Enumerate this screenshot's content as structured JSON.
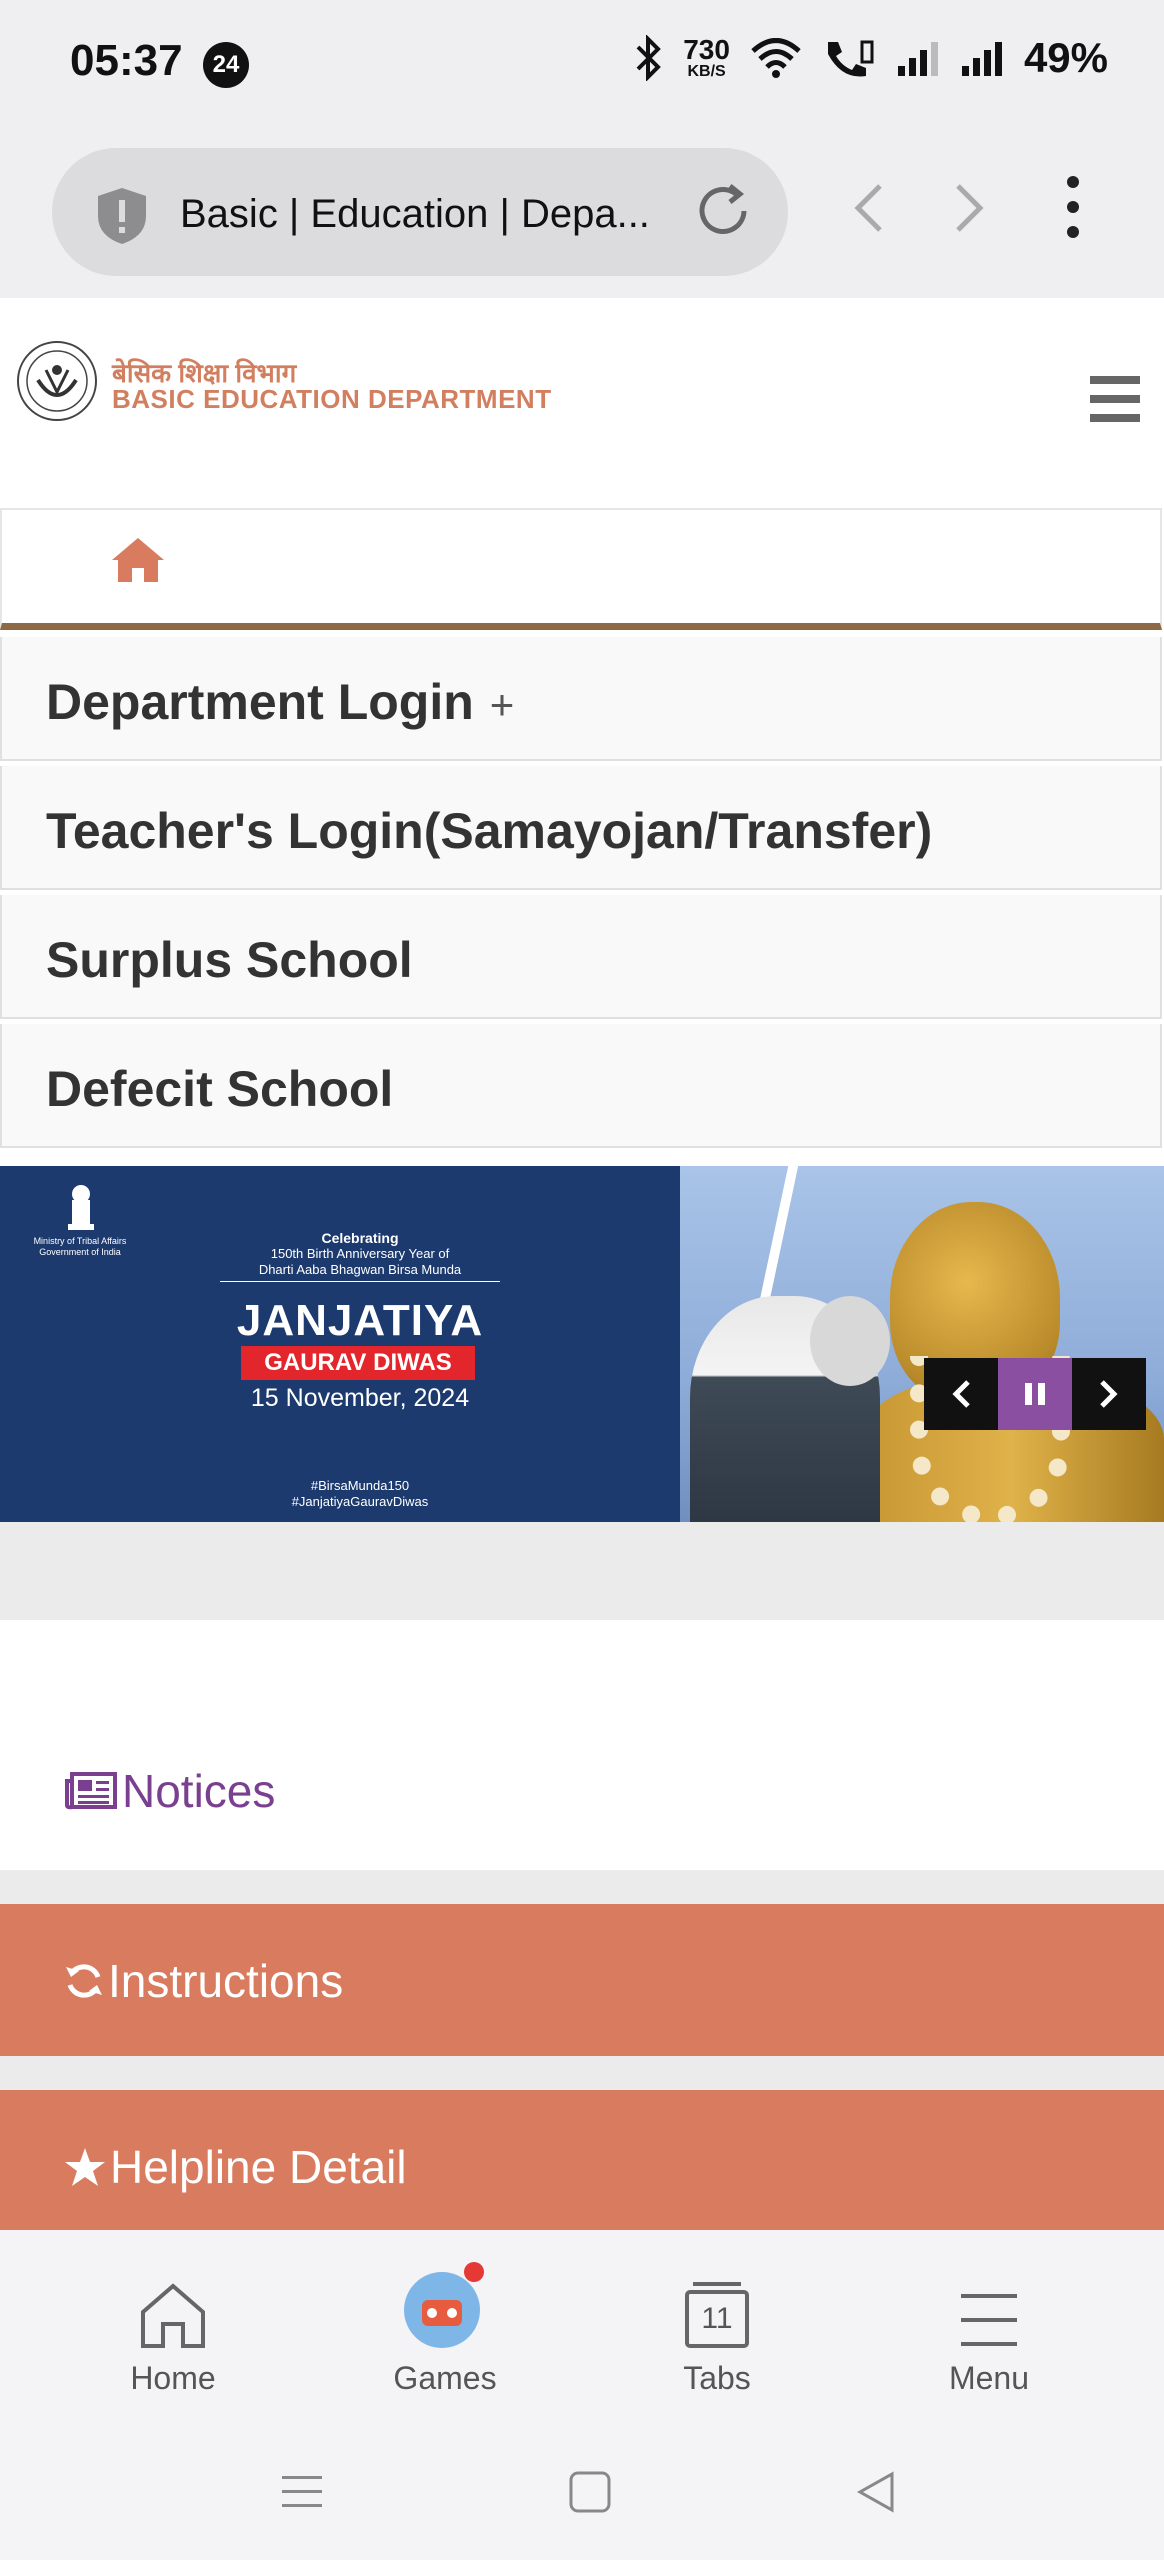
{
  "status_bar": {
    "time": "05:37",
    "notification_count": "24",
    "net_speed_value": "730",
    "net_speed_unit": "KB/S",
    "battery": "49%"
  },
  "browser": {
    "url_title": "Basic | Education | Depa...",
    "shield_icon": "shield-alert-icon",
    "reload_icon": "reload-icon"
  },
  "site": {
    "title_hindi": "बेसिक शिक्षा विभाग",
    "title_english": "BASIC EDUCATION DEPARTMENT",
    "brand_color": "#d27f60"
  },
  "menu": {
    "items": [
      {
        "label": "Department Login",
        "suffix": "+"
      },
      {
        "label": "Teacher's Login(Samayojan/Transfer)"
      },
      {
        "label": "Surplus School"
      },
      {
        "label": "Defecit School"
      }
    ]
  },
  "banner": {
    "ministry": "Ministry of Tribal Affairs Government of India",
    "celebrating": "Celebrating",
    "subtitle_line1": "150th Birth Anniversary Year of",
    "subtitle_line2": "Dharti Aaba Bhagwan Birsa Munda",
    "headline": "JANJATIYA",
    "ribbon": "GAURAV DIWAS",
    "date": "15 November, 2024",
    "hashtag1": "#BirsaMunda150",
    "hashtag2": "#JanjatiyaGauravDiwas"
  },
  "sections": {
    "notices": "Notices",
    "instructions": "Instructions",
    "helpline": "Helpline Detail",
    "accent_color": "#d97b5e"
  },
  "bottom_nav": {
    "home": "Home",
    "games": "Games",
    "tabs": "Tabs",
    "tabs_count": "11",
    "menu": "Menu"
  }
}
